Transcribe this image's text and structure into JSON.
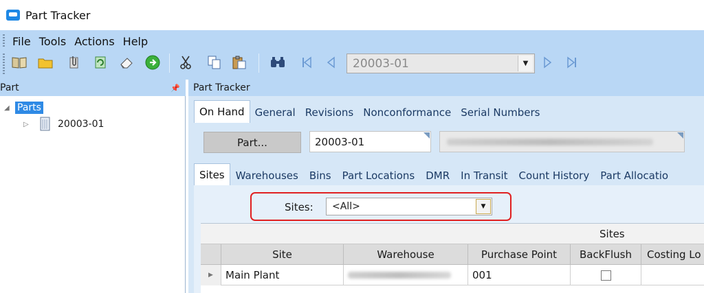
{
  "window": {
    "title": "Part Tracker"
  },
  "menu": {
    "items": [
      "File",
      "Tools",
      "Actions",
      "Help"
    ]
  },
  "toolbar": {
    "icons": [
      "book-icon",
      "folder-icon",
      "attach-icon",
      "refresh-icon",
      "eraser-icon",
      "go-icon",
      "cut-icon",
      "copy-icon",
      "paste-icon",
      "binoculars-icon",
      "first-icon",
      "previous-icon",
      "next-icon",
      "last-icon"
    ],
    "record_value": "20003-01"
  },
  "left_panel": {
    "title": "Part",
    "pin_glyph": "📌",
    "tree": {
      "root_label": "Parts",
      "child_label": "20003-01"
    }
  },
  "right_panel": {
    "title": "Part Tracker"
  },
  "tabs_primary": [
    "On Hand",
    "General",
    "Revisions",
    "Nonconformance",
    "Serial Numbers"
  ],
  "part": {
    "button_label": "Part...",
    "part_number": "20003-01"
  },
  "tabs_secondary": [
    "Sites",
    "Warehouses",
    "Bins",
    "Part Locations",
    "DMR",
    "In Transit",
    "Count History",
    "Part Allocatio"
  ],
  "filter": {
    "label": "Sites:",
    "value": "<All>"
  },
  "grid": {
    "band_title": "Sites",
    "columns": [
      "Site",
      "Warehouse",
      "Purchase Point",
      "BackFlush",
      "Costing Lo"
    ],
    "rows": [
      {
        "site": "Main Plant",
        "purchase_point": "001",
        "backflush": false
      }
    ]
  },
  "colors": {
    "chrome": "#b9d7f5",
    "panel": "#d6e7f7",
    "selection": "#2f8ae5",
    "highlight_frame": "#e02020"
  }
}
